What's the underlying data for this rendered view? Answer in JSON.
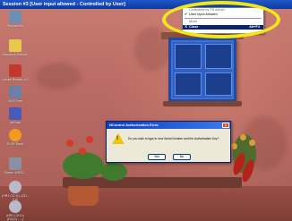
{
  "session": {
    "title": "Session #3 [User input allowed - Controlled by User]"
  },
  "system_menu": {
    "items": [
      {
        "label": "Controlled by TS admin",
        "checked": false
      },
      {
        "label": "User Input Allowed",
        "checked": true
      }
    ],
    "move_label": "Move",
    "close_label": "Close",
    "close_shortcut": "Alt+F4",
    "highlight_color": "#f2e619"
  },
  "dialog": {
    "title": "NControl Authorisation Error",
    "message": "Do you wish to type in new Serial Number and the Authorisation Key?",
    "yes_label": "Yes",
    "no_label": "No",
    "close_glyph": "×"
  },
  "desktop_icons": [
    {
      "label": "Recycle Bin",
      "icon": "recycle-bin-icon",
      "color": "#6d8fb3"
    },
    {
      "label": "Microsoft Outlook",
      "icon": "outlook-icon",
      "color": "#e8c84a"
    },
    {
      "label": "Adobe Reader 6.0",
      "icon": "adobe-reader-icon",
      "color": "#c0392b"
    },
    {
      "label": "AVG Free",
      "icon": "avg-icon",
      "color": "#6c7fa6"
    },
    {
      "label": "ArtScan",
      "icon": "artscan-icon",
      "color": "#4b5bb5"
    },
    {
      "label": "SUPERase",
      "icon": "superase-icon",
      "color": "#f29c1f"
    },
    {
      "label": "Rohrer WN32...",
      "icon": "rohrer-icon",
      "color": "#8b8fa3"
    },
    {
      "label": "(HR1 CD D:) (CD - 2.0)",
      "icon": "cd-drive-icon",
      "color": "#b9b9c9"
    },
    {
      "label": "(HR1 CD D:) (DC(3) - ...)",
      "icon": "cd-drive-icon",
      "color": "#b9b9c9"
    }
  ]
}
